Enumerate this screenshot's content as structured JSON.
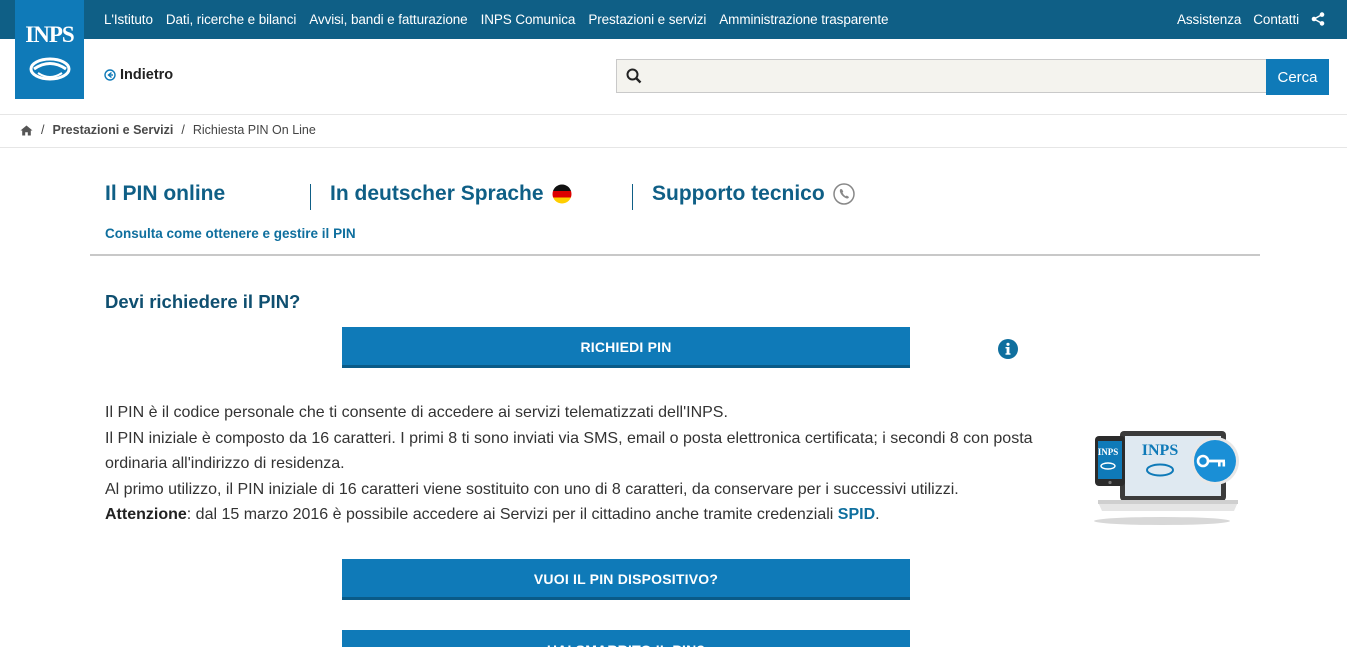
{
  "topnav": {
    "items": [
      "L'Istituto",
      "Dati, ricerche e bilanci",
      "Avvisi, bandi e fatturazione",
      "INPS Comunica",
      "Prestazioni e servizi",
      "Amministrazione trasparente"
    ],
    "assistenza": "Assistenza",
    "contatti": "Contatti",
    "share_icon": "share-icon"
  },
  "logo": {
    "text": "INPS"
  },
  "header": {
    "back_label": "Indietro",
    "search_placeholder": "",
    "search_button": "Cerca"
  },
  "breadcrumb": {
    "home_icon": "home-icon",
    "items": [
      "Prestazioni e Servizi",
      "Richiesta PIN On Line"
    ]
  },
  "tabs": {
    "items": [
      "Il PIN online",
      "In deutscher Sprache",
      "Supporto tecnico"
    ],
    "subtitle": "Consulta come ottenere e gestire il PIN"
  },
  "main": {
    "heading": "Devi richiedere il PIN?",
    "button_richiedi": "RICHIEDI PIN",
    "info_icon": "info-icon",
    "paragraph": {
      "line1": "Il PIN è il codice personale che ti consente di accedere ai servizi telematizzati dell'INPS.",
      "line2": "Il PIN iniziale è composto da 16 caratteri. I primi 8 ti sono inviati via SMS, email o posta elettronica certificata; i secondi 8 con posta ordinaria all'indirizzo di residenza.",
      "line3": "Al primo utilizzo, il PIN iniziale di 16 caratteri viene sostituito con uno di 8 caratteri, da conservare per i successivi utilizzi.",
      "attention_label": "Attenzione",
      "attention_text": ": dal 15 marzo 2016 è possibile accedere ai Servizi per il cittadino anche tramite credenziali ",
      "spid": "SPID",
      "end": "."
    },
    "button_dispositivo": "VUOI IL PIN DISPOSITIVO?",
    "button_smarrito": "HAI SMARRITO IL PIN?",
    "device_logo": "INPS"
  },
  "colors": {
    "topbar": "#0f5f86",
    "accent": "#0f7ab8",
    "heading": "#0f4f70"
  }
}
